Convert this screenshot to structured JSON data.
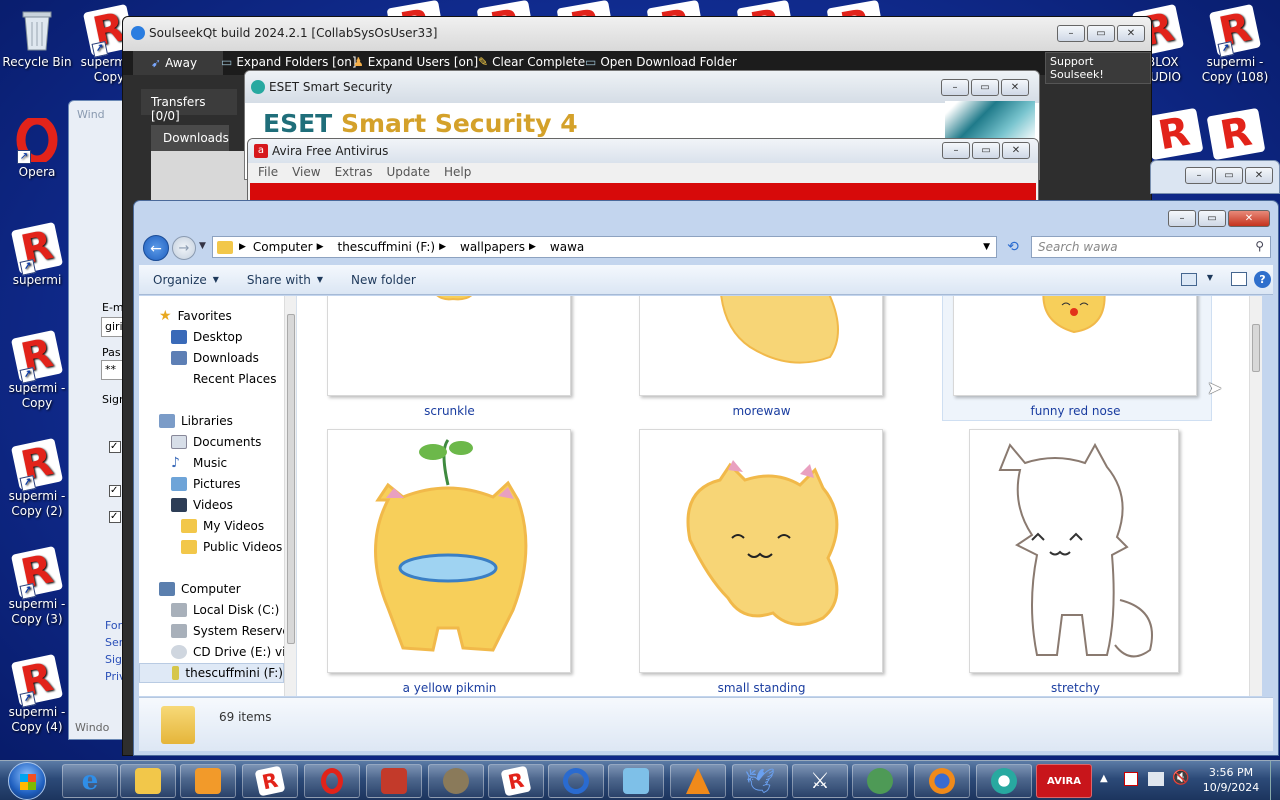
{
  "desktop": {
    "icons": [
      {
        "label": "Recycle Bin",
        "icon": "recycle-bin-icon"
      },
      {
        "label": "supermi - Copy",
        "icon": "roblox-icon"
      },
      {
        "label": "Opera",
        "icon": "opera-icon"
      },
      {
        "label": "supermi",
        "icon": "roblox-icon"
      },
      {
        "label": "supermi - Copy",
        "icon": "roblox-icon"
      },
      {
        "label": "supermi - Copy (2)",
        "icon": "roblox-icon"
      },
      {
        "label": "supermi - Copy (3)",
        "icon": "roblox-icon"
      },
      {
        "label": "supermi - Copy (4)",
        "icon": "roblox-icon"
      },
      {
        "label": "supermi - Copy (108)",
        "icon": "roblox-icon"
      },
      {
        "label": "OBLOX STUDIO",
        "icon": "roblox-icon"
      }
    ]
  },
  "soulseek": {
    "title": "SoulseekQt build 2024.2.1 [CollabSysOsUser33]",
    "away": "Away",
    "expand_folders": "Expand Folders [on]",
    "expand_users": "Expand Users [on]",
    "clear_complete": "Clear Complete",
    "open_download_folder": "Open Download Folder",
    "support": "Support Soulseek!",
    "tab_transfers": "Transfers [0/0]",
    "tab_downloads": "Downloads"
  },
  "eset": {
    "title": "ESET Smart Security",
    "banner_a": "ESET",
    "banner_b": "Smart Security 4"
  },
  "avira": {
    "title": "Avira Free Antivirus",
    "menu": [
      "File",
      "View",
      "Extras",
      "Update",
      "Help"
    ]
  },
  "left_window": {
    "title": "Wind",
    "labels": [
      "E-m",
      "giri",
      "Pas",
      "**",
      "Sign",
      "For",
      "Serv",
      "Sign",
      "Priv",
      "Windo"
    ]
  },
  "explorer": {
    "breadcrumb": [
      "Computer",
      "thescuffmini (F:)",
      "wallpapers",
      "wawa"
    ],
    "search_placeholder": "Search wawa",
    "commands": {
      "organize": "Organize",
      "share_with": "Share with",
      "new_folder": "New folder"
    },
    "nav": [
      {
        "label": "Favorites",
        "icon": "star-icon",
        "level": 0
      },
      {
        "label": "Desktop",
        "icon": "desktop-icon",
        "level": 1
      },
      {
        "label": "Downloads",
        "icon": "downloads-icon",
        "level": 1
      },
      {
        "label": "Recent Places",
        "icon": "recent-places-icon",
        "level": 1
      },
      {
        "label": "Libraries",
        "icon": "libraries-icon",
        "level": 0
      },
      {
        "label": "Documents",
        "icon": "documents-icon",
        "level": 1
      },
      {
        "label": "Music",
        "icon": "music-icon",
        "level": 1
      },
      {
        "label": "Pictures",
        "icon": "pictures-icon",
        "level": 1
      },
      {
        "label": "Videos",
        "icon": "videos-icon",
        "level": 1
      },
      {
        "label": "My Videos",
        "icon": "folder-icon",
        "level": 2
      },
      {
        "label": "Public Videos",
        "icon": "folder-icon",
        "level": 2
      },
      {
        "label": "Computer",
        "icon": "computer-icon",
        "level": 0
      },
      {
        "label": "Local Disk (C:)",
        "icon": "disk-icon",
        "level": 1
      },
      {
        "label": "System Reserved",
        "icon": "disk-icon",
        "level": 1
      },
      {
        "label": "CD Drive (E:) virti",
        "icon": "cd-icon",
        "level": 1
      },
      {
        "label": "thescuffmini (F:)",
        "icon": "usb-drive-icon",
        "level": 1
      }
    ],
    "files": [
      {
        "name": "scrunkle"
      },
      {
        "name": "morewaw"
      },
      {
        "name": "funny red nose"
      },
      {
        "name": "a yellow pikmin"
      },
      {
        "name": "small standing"
      },
      {
        "name": "stretchy"
      }
    ],
    "status_count": "69 items"
  },
  "taskbar": {
    "time": "3:56 PM",
    "date": "10/9/2024",
    "apps": [
      "explorer",
      "internet-explorer",
      "file-explorer",
      "media-player",
      "roblox",
      "opera",
      "toolbox",
      "gimp",
      "roblox-studio",
      "chrome",
      "paint",
      "vlc",
      "bird-app",
      "sword-app",
      "people-app",
      "firefox",
      "eset",
      "avira"
    ]
  }
}
